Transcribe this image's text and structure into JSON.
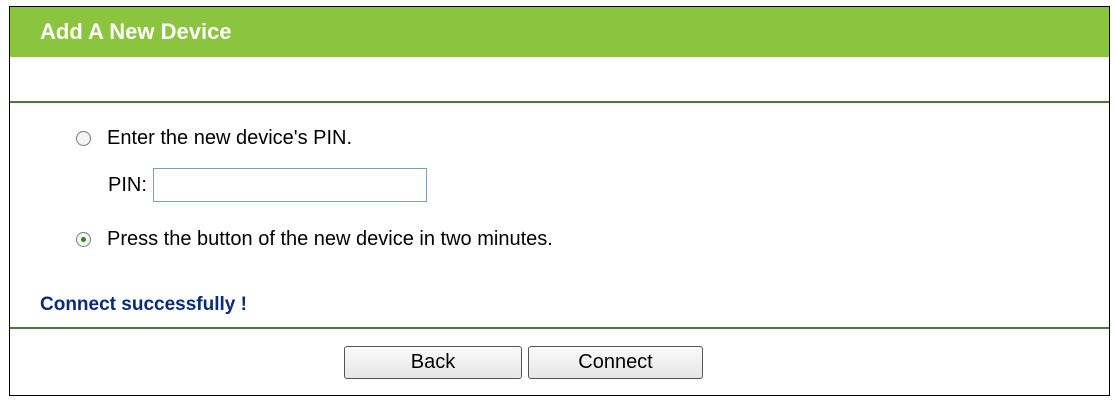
{
  "header": {
    "title": "Add A New Device"
  },
  "options": {
    "pin_option_label": "Enter the new device's PIN.",
    "pin_option_selected": false,
    "pin_label": "PIN:",
    "pin_value": "",
    "button_option_label": "Press the button of the new device in two minutes.",
    "button_option_selected": true
  },
  "status": {
    "message": "Connect successfully !"
  },
  "buttons": {
    "back_label": "Back",
    "connect_label": "Connect"
  },
  "colors": {
    "header_bg": "#8bc53f",
    "divider": "#4a7a3e",
    "status_text": "#0a2a80"
  }
}
